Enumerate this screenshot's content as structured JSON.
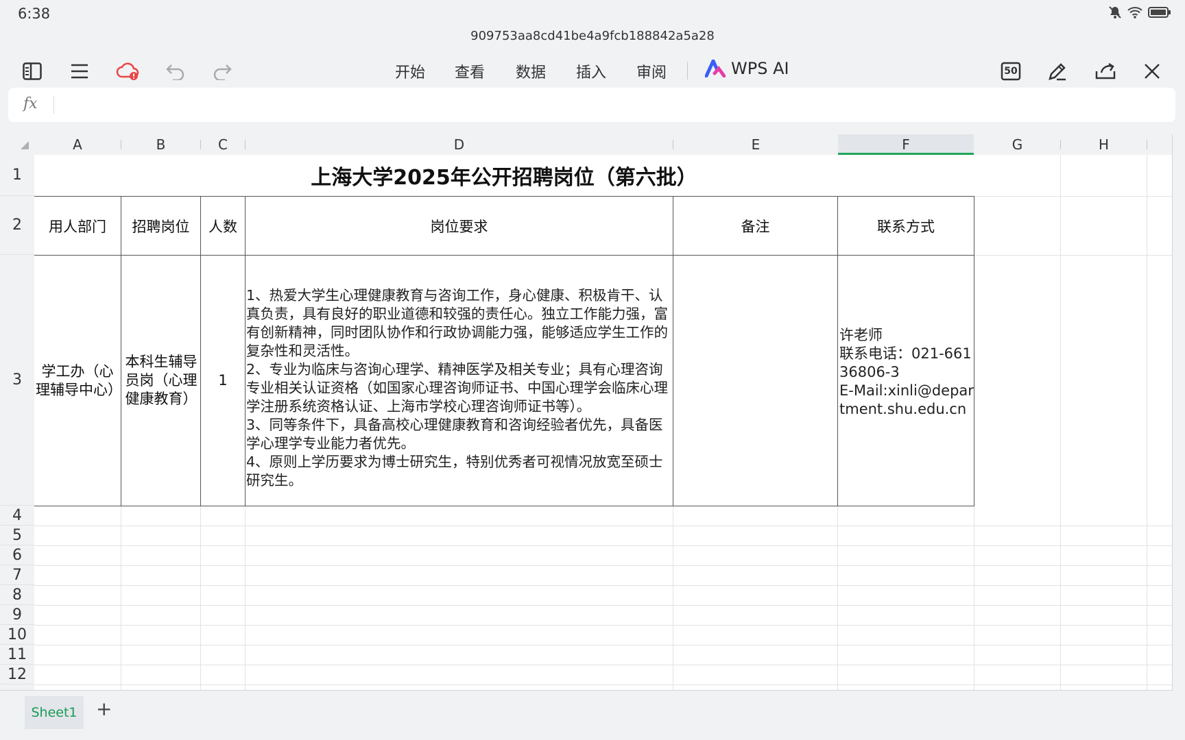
{
  "status": {
    "time": "6:38"
  },
  "document": {
    "filename": "909753aa8cd41be4a9fcb188842a5a28"
  },
  "menu": {
    "items": [
      "开始",
      "查看",
      "数据",
      "插入",
      "审阅"
    ],
    "ai_label": "WPS AI"
  },
  "toolbar": {
    "page_badge": "50"
  },
  "formula_bar": {
    "fx_label": "fx",
    "value": ""
  },
  "columns": [
    "A",
    "B",
    "C",
    "D",
    "E",
    "F",
    "G",
    "H"
  ],
  "selected_column": "F",
  "rows": [
    "1",
    "2",
    "3",
    "4",
    "5",
    "6",
    "7",
    "8",
    "9",
    "10",
    "11",
    "12"
  ],
  "sheet": {
    "title": "上海大学2025年公开招聘岗位（第六批）",
    "headers": [
      "用人部门",
      "招聘岗位",
      "人数",
      "岗位要求",
      "备注",
      "联系方式"
    ],
    "row3": {
      "department": "学工办（心理辅导中心）",
      "position": "本科生辅导员岗（心理健康教育）",
      "count": "1",
      "requirements": "1、热爱大学生心理健康教育与咨询工作，身心健康、积极肯干、认真负责，具有良好的职业道德和较强的责任心。独立工作能力强，富有创新精神，同时团队协作和行政协调能力强，能够适应学生工作的复杂性和灵活性。\n2、专业为临床与咨询心理学、精神医学及相关专业；具有心理咨询专业相关认证资格（如国家心理咨询师证书、中国心理学会临床心理学注册系统资格认证、上海市学校心理咨询师证书等）。\n3、同等条件下，具备高校心理健康教育和咨询经验者优先，具备医学心理学专业能力者优先。\n4、原则上学历要求为博士研究生，特别优秀者可视情况放宽至硕士研究生。",
      "remark": "",
      "contact": "许老师\n联系电话：021-66136806-3\nE-Mail:xinli@department.shu.edu.cn"
    }
  },
  "tabs": {
    "sheet1": "Sheet1",
    "add": "+"
  }
}
